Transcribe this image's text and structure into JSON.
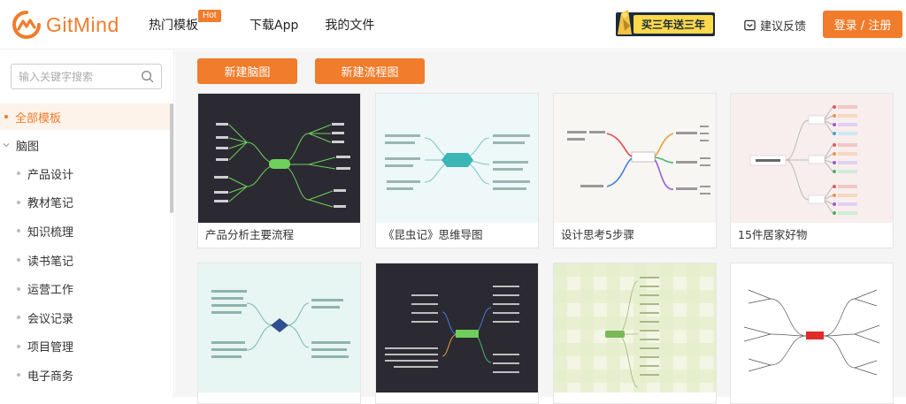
{
  "header": {
    "logo_text": "GitMind",
    "nav": [
      {
        "label": "热门模板",
        "badge": "Hot"
      },
      {
        "label": "下载App"
      },
      {
        "label": "我的文件"
      }
    ],
    "promo_text": "买三年送三年",
    "feedback_label": "建议反馈",
    "login_label": "登录 / 注册"
  },
  "sidebar": {
    "search_placeholder": "输入关键字搜索",
    "all_label": "全部模板",
    "mind_label": "脑图",
    "items": [
      "产品设计",
      "教材笔记",
      "知识梳理",
      "读书笔记",
      "运营工作",
      "会议记录",
      "项目管理",
      "电子商务"
    ]
  },
  "main": {
    "new_mindmap_label": "新建脑图",
    "new_flowchart_label": "新建流程图",
    "cards": [
      {
        "title": "产品分析主要流程"
      },
      {
        "title": "《昆虫记》思维导图"
      },
      {
        "title": "设计思考5步骤"
      },
      {
        "title": "15件居家好物"
      }
    ]
  },
  "colors": {
    "accent": "#f07c2c",
    "sidebar_active_bg": "#fdf3eb",
    "main_bg": "#f5f5f5"
  }
}
